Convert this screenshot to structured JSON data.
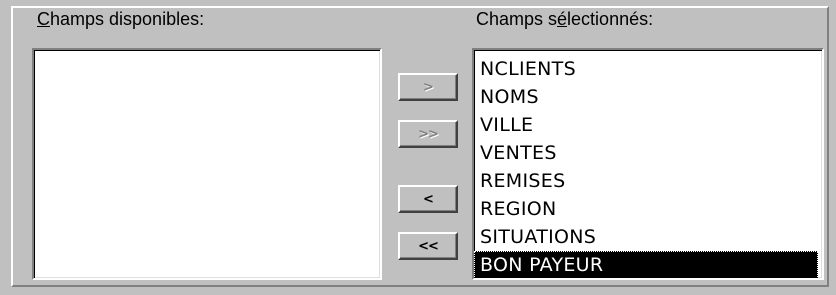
{
  "available": {
    "label_mnemonic": "C",
    "label_rest": "hamps disponibles:",
    "items": []
  },
  "selected": {
    "label_pre": "Champs s",
    "label_mnemonic": "é",
    "label_post": "lectionnés:",
    "items": [
      "NCLIENTS",
      "NOMS",
      "VILLE",
      "VENTES",
      "REMISES",
      "REGION",
      "SITUATIONS",
      "BON PAYEUR"
    ],
    "selected_item": "BON PAYEUR"
  },
  "buttons": {
    "add": {
      "label": ">",
      "enabled": false
    },
    "add_all": {
      "label": ">>",
      "enabled": false
    },
    "remove": {
      "label": "<",
      "enabled": true
    },
    "remove_all": {
      "label": "<<",
      "enabled": true
    }
  },
  "colors": {
    "dialog_background": "#c0c0c0",
    "list_background": "#ffffff",
    "selection_background": "#000000",
    "selection_text": "#ffffff",
    "disabled_text": "#808080"
  }
}
